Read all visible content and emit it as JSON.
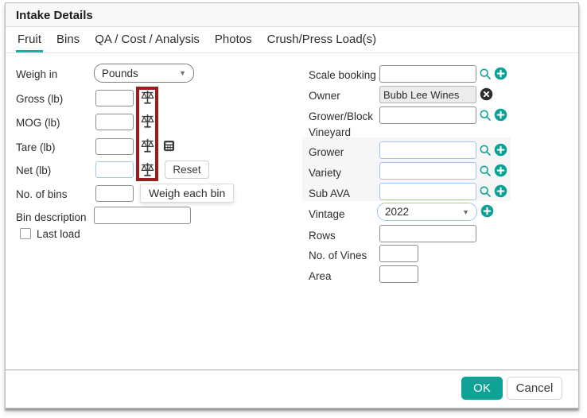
{
  "window": {
    "title": "Intake Details"
  },
  "tabs": [
    {
      "label": "Fruit"
    },
    {
      "label": "Bins"
    },
    {
      "label": "QA / Cost / Analysis"
    },
    {
      "label": "Photos"
    },
    {
      "label": "Crush/Press Load(s)"
    }
  ],
  "left": {
    "weigh_in_label": "Weigh in",
    "weigh_in_value": "Pounds",
    "gross_label": "Gross (lb)",
    "mog_label": "MOG (lb)",
    "tare_label": "Tare (lb)",
    "net_label": "Net (lb)",
    "bins_label": "No. of bins",
    "bin_description_label": "Bin description",
    "last_load_label": "Last load",
    "reset_button": "Reset",
    "weigh_each_bin_tooltip": "Weigh each bin"
  },
  "right": {
    "scale_booking_label": "Scale booking",
    "owner_label": "Owner",
    "owner_value": "Bubb Lee Wines",
    "grower_block_label": "Grower/Block",
    "vineyard_label": "Vineyard",
    "grower_label": "Grower",
    "variety_label": "Variety",
    "sub_ava_label": "Sub AVA",
    "vintage_label": "Vintage",
    "vintage_value": "2022",
    "rows_label": "Rows",
    "vines_label": "No. of Vines",
    "area_label": "Area"
  },
  "footer": {
    "ok": "OK",
    "cancel": "Cancel"
  },
  "colors": {
    "accent_teal": "#0fa396",
    "tab_underline": "#14b0a2",
    "highlight_red": "#9c1b1f",
    "focus_blue": "#a4c2f0",
    "icon_dark": "#3a3a3a"
  }
}
